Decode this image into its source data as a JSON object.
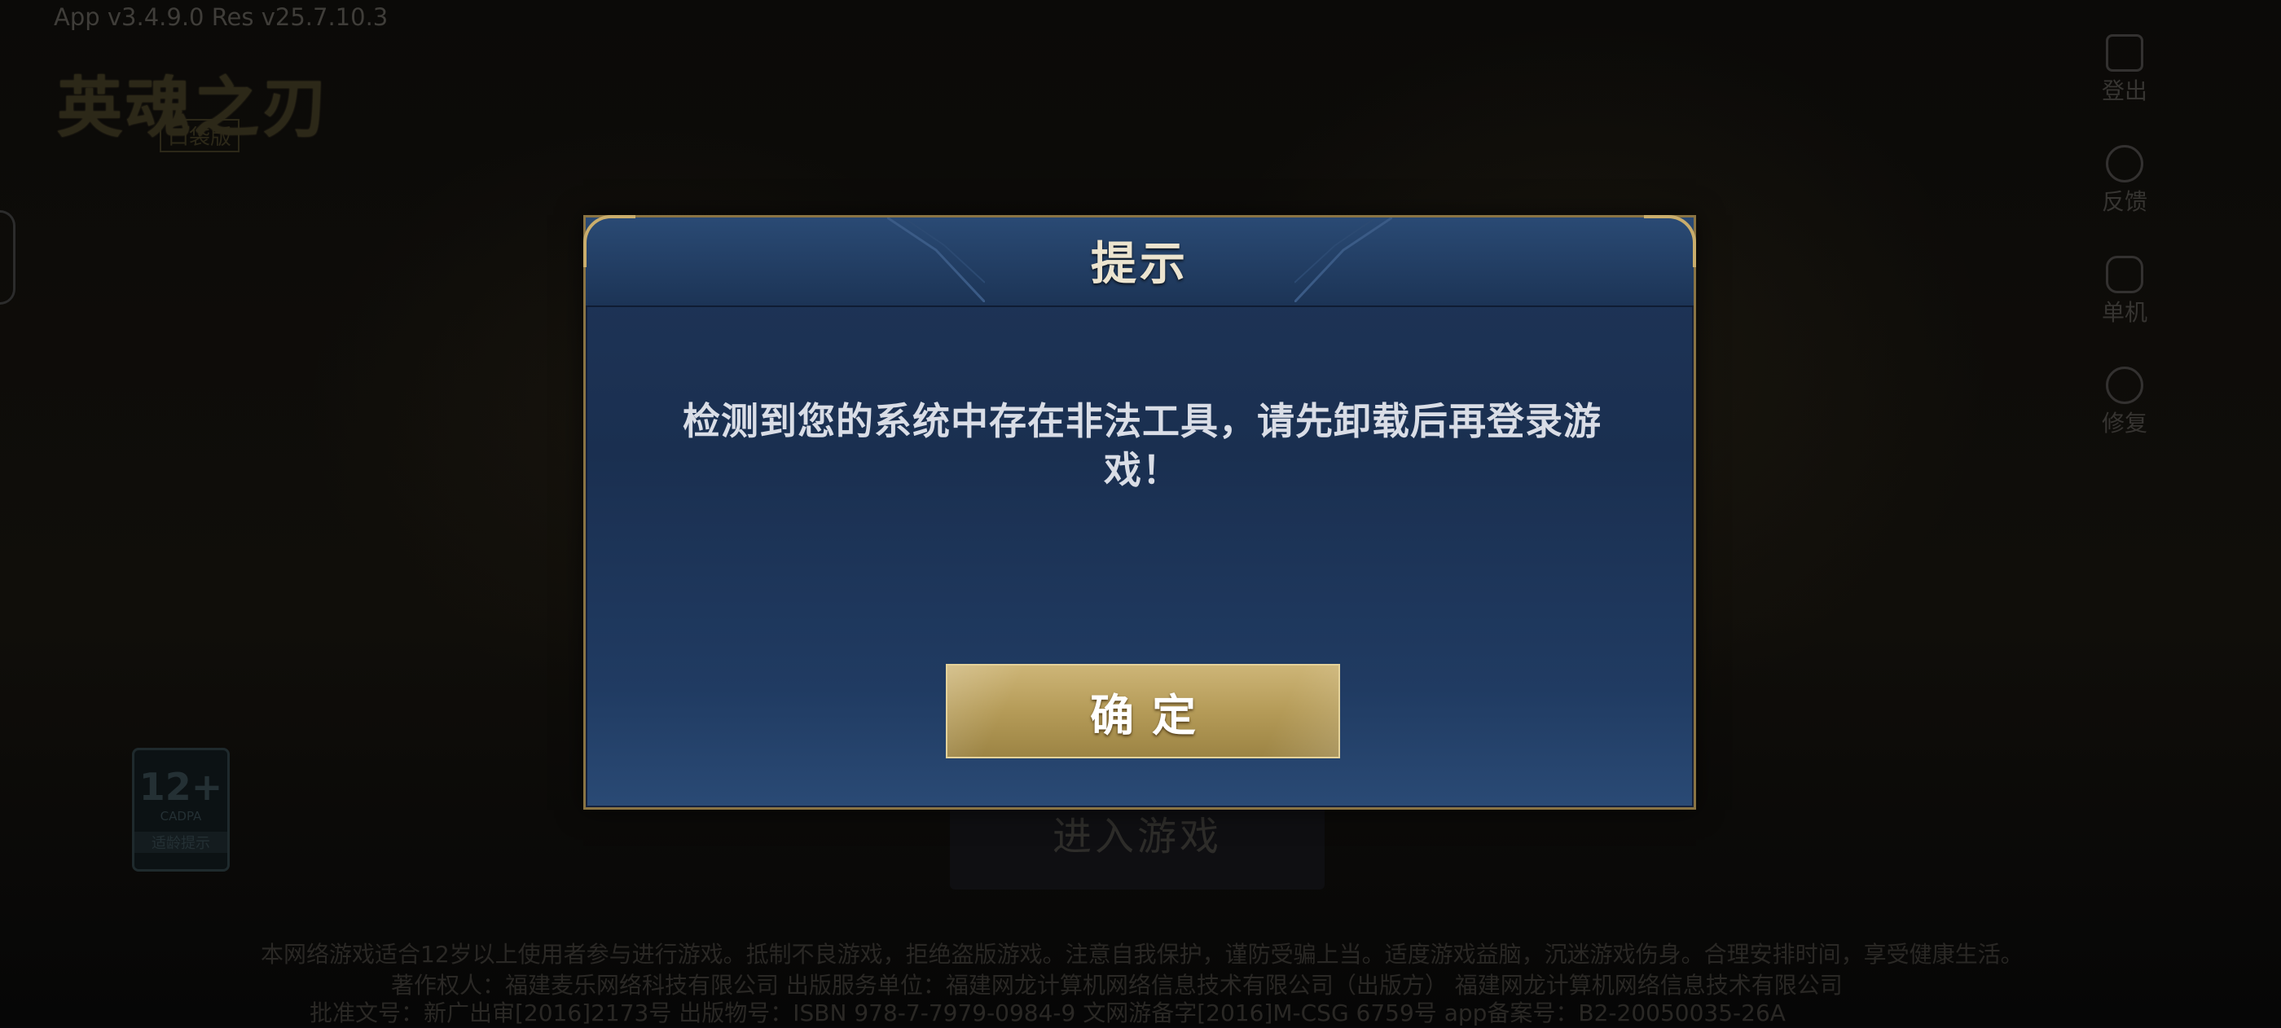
{
  "app": {
    "version_text": "App v3.4.9.0  Res v25.7.10.3",
    "logo_title": "英魂之刃",
    "logo_sub": "口袋版"
  },
  "side_menu": [
    {
      "icon": "logout-icon",
      "label": "登出"
    },
    {
      "icon": "feedback-icon",
      "label": "反馈"
    },
    {
      "icon": "gamepad-icon",
      "label": "单机"
    },
    {
      "icon": "gear-icon",
      "label": "修复"
    }
  ],
  "age_rating": {
    "age": "12+",
    "code": "CADPA",
    "tip": "适龄提示"
  },
  "enter_game_label": "进入游戏",
  "footer": {
    "line1": "本网络游戏适合12岁以上使用者参与进行游戏。抵制不良游戏，拒绝盗版游戏。注意自我保护，谨防受骗上当。适度游戏益脑，沉迷游戏伤身。合理安排时间，享受健康生活。",
    "line2": "著作权人：福建麦乐网络科技有限公司  出版服务单位：福建网龙计算机网络信息技术有限公司（出版方）  福建网龙计算机网络信息技术有限公司",
    "line3": "批准文号：新广出审[2016]2173号  出版物号：ISBN 978-7-7979-0984-9  文网游备字[2016]M-CSG 6759号  app备案号：B2-20050035-26A"
  },
  "dialog": {
    "title": "提示",
    "message": "检测到您的系统中存在非法工具，请先卸载后再登录游戏！",
    "confirm_label": "确定"
  },
  "colors": {
    "dialog_border": "#8a7444",
    "dialog_bg": "#1f3558",
    "button_gold": "#b59b58"
  }
}
